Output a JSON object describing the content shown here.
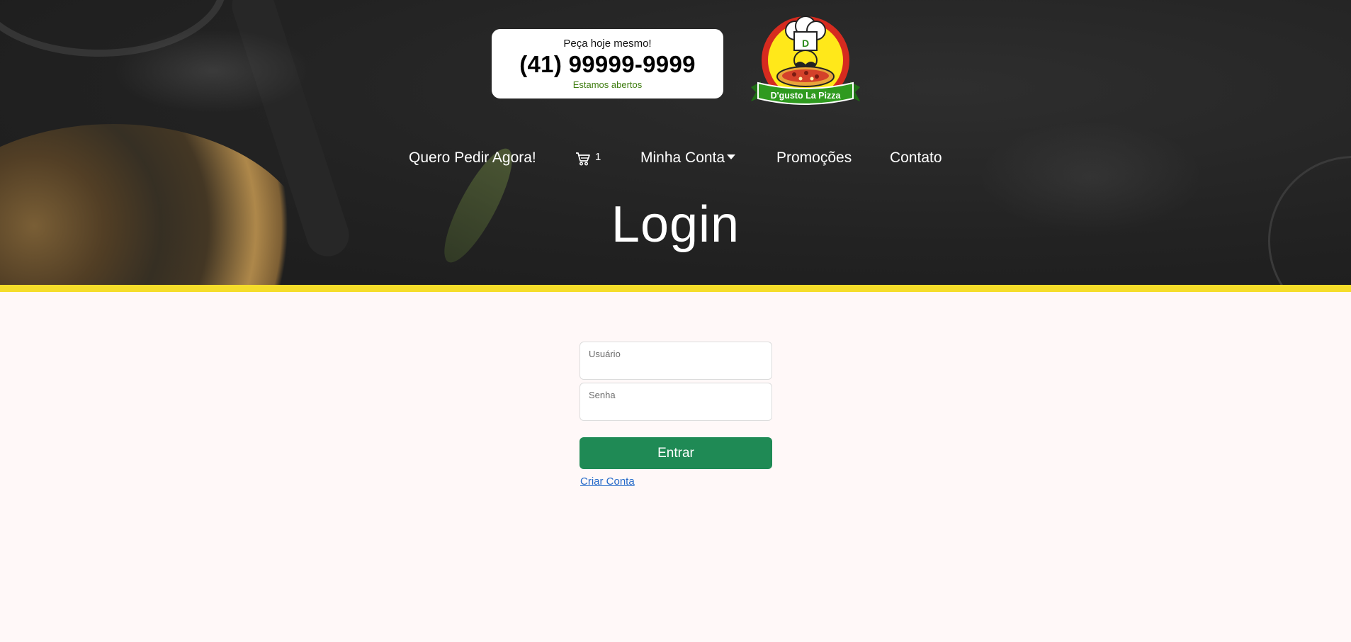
{
  "header": {
    "phone_card": {
      "prompt": "Peça hoje mesmo!",
      "phone": "(41) 99999-9999",
      "status": "Estamos abertos"
    },
    "logo": {
      "brand_text": "D'gusto La Pizza",
      "hat_letter": "D"
    }
  },
  "nav": {
    "items": [
      {
        "label": "Quero Pedir Agora!"
      },
      {
        "label": "",
        "icon": "cart-icon",
        "badge": "1"
      },
      {
        "label": "Minha Conta",
        "icon": "caret-down-icon"
      },
      {
        "label": "Promoções"
      },
      {
        "label": "Contato"
      }
    ]
  },
  "page": {
    "title": "Login"
  },
  "login_form": {
    "username_label": "Usuário",
    "username_value": "",
    "password_label": "Senha",
    "password_value": "",
    "submit_label": "Entrar",
    "create_account_label": "Criar Conta"
  },
  "colors": {
    "accent_yellow": "#f5dd2a",
    "button_green": "#1f8a55",
    "link_blue": "#2469c9",
    "status_green": "#3f7d10",
    "background": "#fff8f8"
  }
}
